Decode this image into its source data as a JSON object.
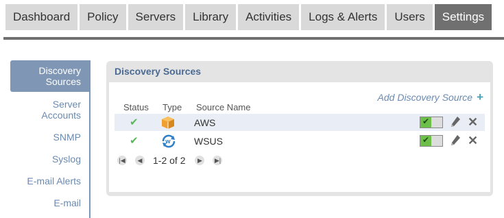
{
  "nav": {
    "tabs": [
      {
        "label": "Dashboard"
      },
      {
        "label": "Policy"
      },
      {
        "label": "Servers"
      },
      {
        "label": "Library"
      },
      {
        "label": "Activities"
      },
      {
        "label": "Logs & Alerts"
      },
      {
        "label": "Users"
      },
      {
        "label": "Settings"
      }
    ],
    "active_tab": "Settings"
  },
  "sidebar": {
    "items": [
      {
        "label": "Discovery Sources"
      },
      {
        "label": "Server Accounts"
      },
      {
        "label": "SNMP"
      },
      {
        "label": "Syslog"
      },
      {
        "label": "E-mail Alerts"
      },
      {
        "label": "E-mail"
      }
    ],
    "active_item": "Discovery Sources"
  },
  "panel": {
    "title": "Discovery Sources",
    "add_label": "Add Discovery Source",
    "columns": [
      "Status",
      "Type",
      "Source Name"
    ],
    "rows": [
      {
        "status_icon": "check-icon",
        "type_icon": "aws-box-icon",
        "name": "AWS",
        "enabled": true
      },
      {
        "status_icon": "check-icon",
        "type_icon": "wsus-icon",
        "name": "WSUS",
        "enabled": true
      }
    ],
    "pager": {
      "text": "1-2 of 2"
    }
  },
  "colors": {
    "accent": "#7f97b5",
    "active_tab": "#707070",
    "tab_bg": "#d9d9d9",
    "check": "#5cb85c",
    "toggle_on": "#6cc04a"
  }
}
